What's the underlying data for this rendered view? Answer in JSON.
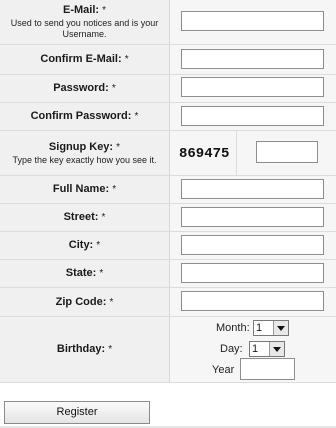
{
  "required_mark": "*",
  "fields": {
    "email": {
      "label": "E-Mail:",
      "hint": "Used to send you notices and is your Username.",
      "value": ""
    },
    "confirm_email": {
      "label": "Confirm E-Mail:",
      "value": ""
    },
    "password": {
      "label": "Password:",
      "value": ""
    },
    "confirm_password": {
      "label": "Confirm Password:",
      "value": ""
    },
    "signup_key": {
      "label": "Signup Key:",
      "hint": "Type the key exactly how you see it.",
      "captcha": "869475",
      "value": ""
    },
    "full_name": {
      "label": "Full Name:",
      "value": ""
    },
    "street": {
      "label": "Street:",
      "value": ""
    },
    "city": {
      "label": "City:",
      "value": ""
    },
    "state": {
      "label": "State:",
      "value": ""
    },
    "zip_code": {
      "label": "Zip Code:",
      "value": ""
    },
    "birthday": {
      "label": "Birthday:",
      "month_label": "Month:",
      "month_value": "1",
      "day_label": "Day:",
      "day_value": "1",
      "year_label": "Year",
      "year_value": ""
    }
  },
  "register_label": "Register"
}
